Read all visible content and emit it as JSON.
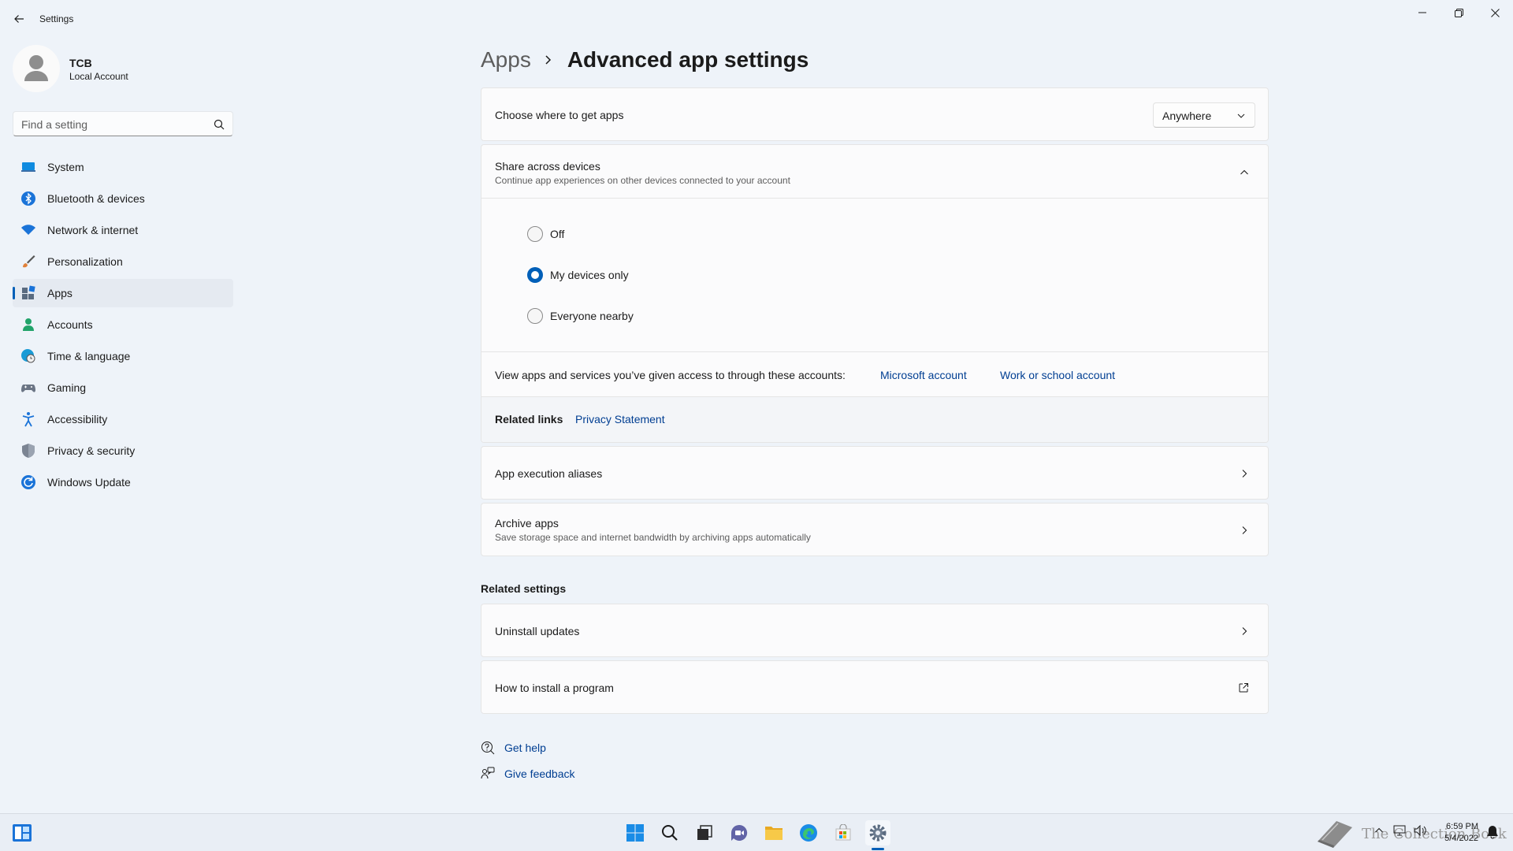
{
  "window": {
    "title": "Settings",
    "controls": [
      "minimize",
      "restore",
      "close"
    ]
  },
  "profile": {
    "name": "TCB",
    "account_type": "Local Account"
  },
  "search": {
    "placeholder": "Find a setting"
  },
  "sidebar": {
    "items": [
      {
        "label": "System",
        "icon": "system-icon",
        "active": false
      },
      {
        "label": "Bluetooth & devices",
        "icon": "bluetooth-icon",
        "active": false
      },
      {
        "label": "Network & internet",
        "icon": "wifi-icon",
        "active": false
      },
      {
        "label": "Personalization",
        "icon": "brush-icon",
        "active": false
      },
      {
        "label": "Apps",
        "icon": "apps-icon",
        "active": true
      },
      {
        "label": "Accounts",
        "icon": "person-icon",
        "active": false
      },
      {
        "label": "Time & language",
        "icon": "globe-clock-icon",
        "active": false
      },
      {
        "label": "Gaming",
        "icon": "controller-icon",
        "active": false
      },
      {
        "label": "Accessibility",
        "icon": "accessibility-icon",
        "active": false
      },
      {
        "label": "Privacy & security",
        "icon": "shield-icon",
        "active": false
      },
      {
        "label": "Windows Update",
        "icon": "update-icon",
        "active": false
      }
    ]
  },
  "breadcrumb": {
    "parent": "Apps",
    "current": "Advanced app settings"
  },
  "main": {
    "get_apps": {
      "title": "Choose where to get apps",
      "dropdown_value": "Anywhere"
    },
    "share": {
      "title": "Share across devices",
      "subtitle": "Continue app experiences on other devices connected to your account",
      "options": [
        {
          "label": "Off",
          "checked": false
        },
        {
          "label": "My devices only",
          "checked": true
        },
        {
          "label": "Everyone nearby",
          "checked": false
        }
      ],
      "accounts_text": "View apps and services you’ve given access to through these accounts:",
      "microsoft_account_link": "Microsoft account",
      "work_account_link": "Work or school account",
      "related_links_label": "Related links",
      "privacy_link": "Privacy Statement"
    },
    "aliases": {
      "title": "App execution aliases"
    },
    "archive": {
      "title": "Archive apps",
      "subtitle": "Save storage space and internet bandwidth by archiving apps automatically"
    },
    "related_settings": {
      "heading": "Related settings",
      "uninstall_updates": "Uninstall updates",
      "how_to_install": "How to install a program"
    },
    "help": {
      "get_help": "Get help",
      "give_feedback": "Give feedback"
    }
  },
  "taskbar": {
    "time": "6:59 PM",
    "date": "5/4/2022",
    "watermark": "The Collection Book",
    "accent": "#005fb8"
  }
}
